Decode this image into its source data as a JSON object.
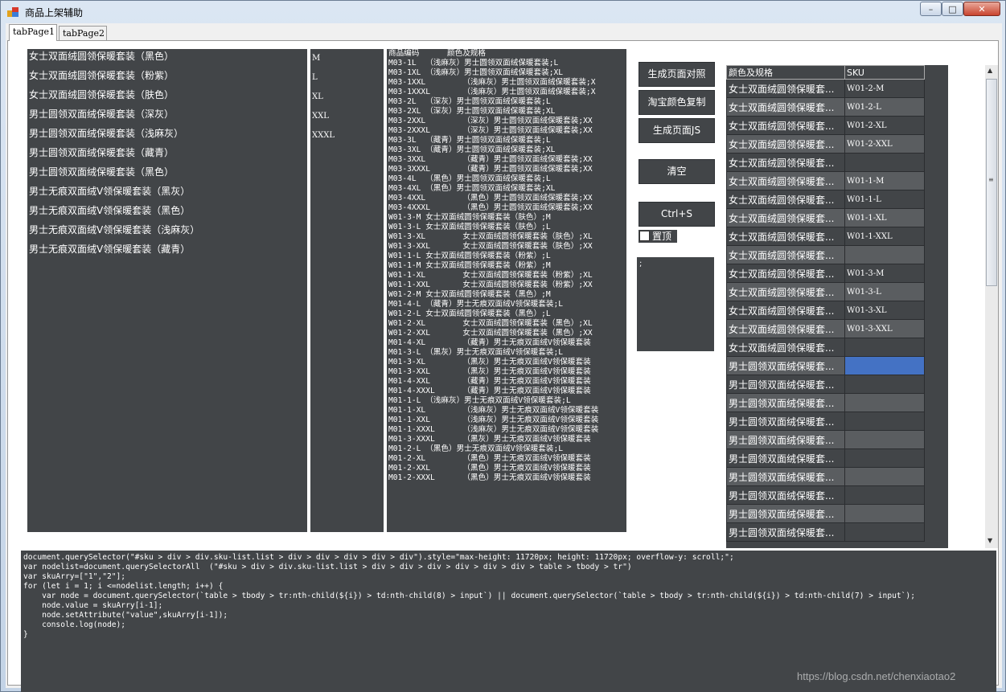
{
  "window": {
    "title": "商品上架辅助"
  },
  "tabs": [
    {
      "label": "tabPage1"
    },
    {
      "label": "tabPage2"
    }
  ],
  "product_list": [
    "女士双面绒圆领保暖套装（黑色）",
    "女士双面绒圆领保暖套装（粉紫）",
    "女士双面绒圆领保暖套装（肤色）",
    "男士圆领双面绒保暖套装（深灰）",
    "男士圆领双面绒保暖套装（浅麻灰）",
    "男士圆领双面绒保暖套装（藏青）",
    "男士圆领双面绒保暖套装（黑色）",
    "男士无痕双面绒V领保暖套装（黑灰）",
    "男士无痕双面绒V领保暖套装（黑色）",
    "男士无痕双面绒V领保暖套装（浅麻灰）",
    "男士无痕双面绒V领保暖套装（藏青）"
  ],
  "size_list": [
    "M",
    "L",
    "XL",
    "XXL",
    "XXXL"
  ],
  "code_list_header": "商品编码      颜色及规格",
  "code_list": [
    "M03-1L  （浅麻灰）男士圆领双面绒保暖套装;L",
    "M03-1XL （浅麻灰）男士圆领双面绒保暖套装;XL",
    "M03-1XXL        （浅麻灰）男士圆领双面绒保暖套装;X",
    "M03-1XXXL       （浅麻灰）男士圆领双面绒保暖套装;X",
    "M03-2L  （深灰）男士圆领双面绒保暖套装;L",
    "M03-2XL （深灰）男士圆领双面绒保暖套装;XL",
    "M03-2XXL        （深灰）男士圆领双面绒保暖套装;XX",
    "M03-2XXXL       （深灰）男士圆领双面绒保暖套装;XX",
    "M03-3L  （藏青）男士圆领双面绒保暖套装;L",
    "M03-3XL （藏青）男士圆领双面绒保暖套装;XL",
    "M03-3XXL        （藏青）男士圆领双面绒保暖套装;XX",
    "M03-3XXXL       （藏青）男士圆领双面绒保暖套装;XX",
    "M03-4L  （黑色）男士圆领双面绒保暖套装;L",
    "M03-4XL （黑色）男士圆领双面绒保暖套装;XL",
    "M03-4XXL        （黑色）男士圆领双面绒保暖套装;XX",
    "M03-4XXXL       （黑色）男士圆领双面绒保暖套装;XX",
    "W01-3-M 女士双面绒圆领保暖套装（肤色）;M",
    "W01-3-L 女士双面绒圆领保暖套装（肤色）;L",
    "W01-3-XL        女士双面绒圆领保暖套装（肤色）;XL",
    "W01-3-XXL       女士双面绒圆领保暖套装（肤色）;XX",
    "W01-1-L 女士双面绒圆领保暖套装（粉紫）;L",
    "W01-1-M 女士双面绒圆领保暖套装（粉紫）;M",
    "W01-1-XL        女士双面绒圆领保暖套装（粉紫）;XL",
    "W01-1-XXL       女士双面绒圆领保暖套装（粉紫）;XX",
    "W01-2-M 女士双面绒圆领保暖套装（黑色）;M",
    "M01-4-L （藏青）男士无痕双面绒V领保暖套装;L",
    "W01-2-L 女士双面绒圆领保暖套装（黑色）;L",
    "W01-2-XL        女士双面绒圆领保暖套装（黑色）;XL",
    "W01-2-XXL       女士双面绒圆领保暖套装（黑色）;XX",
    "M01-4-XL        （藏青）男士无痕双面绒V领保暖套装",
    "M01-3-L （黑灰）男士无痕双面绒V领保暖套装;L",
    "M01-3-XL        （黑灰）男士无痕双面绒V领保暖套装",
    "M01-3-XXL       （黑灰）男士无痕双面绒V领保暖套装",
    "M01-4-XXL       （藏青）男士无痕双面绒V领保暖套装",
    "M01-4-XXXL      （藏青）男士无痕双面绒V领保暖套装",
    "M01-1-L （浅麻灰）男士无痕双面绒V领保暖套装;L",
    "M01-1-XL        （浅麻灰）男士无痕双面绒V领保暖套装",
    "M01-1-XXL       （浅麻灰）男士无痕双面绒V领保暖套装",
    "M01-1-XXXL      （浅麻灰）男士无痕双面绒V领保暖套装",
    "M01-3-XXXL      （黑灰）男士无痕双面绒V领保暖套装",
    "M01-2-L （黑色）男士无痕双面绒V领保暖套装;L",
    "M01-2-XL        （黑色）男士无痕双面绒V领保暖套装",
    "M01-2-XXL       （黑色）男士无痕双面绒V领保暖套装",
    "M01-2-XXXL      （黑色）男士无痕双面绒V领保暖套装"
  ],
  "buttons": {
    "generate_page_match": "生成页面对照",
    "taobao_color_copy": "淘宝颜色复制",
    "generate_page_js": "生成页面JS",
    "clear": "清空",
    "ctrl_s": "Ctrl+S"
  },
  "pin_checkbox": {
    "label": "置顶",
    "checked": false
  },
  "small_output": ";",
  "grid": {
    "headers": [
      "颜色及规格",
      "SKU"
    ],
    "rows": [
      {
        "name": "女士双面绒圆领保暖套...",
        "sku": "W01-2-M"
      },
      {
        "name": "女士双面绒圆领保暖套...",
        "sku": "W01-2-L"
      },
      {
        "name": "女士双面绒圆领保暖套...",
        "sku": "W01-2-XL"
      },
      {
        "name": "女士双面绒圆领保暖套...",
        "sku": "W01-2-XXL"
      },
      {
        "name": "女士双面绒圆领保暖套...",
        "sku": ""
      },
      {
        "name": "女士双面绒圆领保暖套...",
        "sku": "W01-1-M"
      },
      {
        "name": "女士双面绒圆领保暖套...",
        "sku": "W01-1-L"
      },
      {
        "name": "女士双面绒圆领保暖套...",
        "sku": "W01-1-XL"
      },
      {
        "name": "女士双面绒圆领保暖套...",
        "sku": "W01-1-XXL"
      },
      {
        "name": "女士双面绒圆领保暖套...",
        "sku": ""
      },
      {
        "name": "女士双面绒圆领保暖套...",
        "sku": "W01-3-M"
      },
      {
        "name": "女士双面绒圆领保暖套...",
        "sku": "W01-3-L"
      },
      {
        "name": "女士双面绒圆领保暖套...",
        "sku": "W01-3-XL"
      },
      {
        "name": "女士双面绒圆领保暖套...",
        "sku": "W01-3-XXL"
      },
      {
        "name": "女士双面绒圆领保暖套...",
        "sku": ""
      },
      {
        "name": "男士圆领双面绒保暖套...",
        "sku": "",
        "selected": true
      },
      {
        "name": "男士圆领双面绒保暖套...",
        "sku": ""
      },
      {
        "name": "男士圆领双面绒保暖套...",
        "sku": ""
      },
      {
        "name": "男士圆领双面绒保暖套...",
        "sku": ""
      },
      {
        "name": "男士圆领双面绒保暖套...",
        "sku": ""
      },
      {
        "name": "男士圆领双面绒保暖套...",
        "sku": ""
      },
      {
        "name": "男士圆领双面绒保暖套...",
        "sku": ""
      },
      {
        "name": "男士圆领双面绒保暖套...",
        "sku": ""
      },
      {
        "name": "男士圆领双面绒保暖套...",
        "sku": ""
      },
      {
        "name": "男士圆领双面绒保暖套...",
        "sku": ""
      }
    ]
  },
  "code_output": "document.querySelector(\"#sku > div > div.sku-list.list > div > div > div > div > div\").style=\"max-height: 11720px; height: 11720px; overflow-y: scroll;\";\nvar nodelist=document.querySelectorAll  (\"#sku > div > div.sku-list.list > div > div > div > div > div > div > table > tbody > tr\")\nvar skuArry=[\"1\",\"2\"];\nfor (let i = 1; i <=nodelist.length; i++) {\n    var node = document.querySelector(`table > tbody > tr:nth-child(${i}) > td:nth-child(8) > input`) || document.querySelector(`table > tbody > tr:nth-child(${i}) > td:nth-child(7) > input`);\n    node.value = skuArry[i-1];\n    node.setAttribute(\"value\",skuArry[i-1]);\n    console.log(node);\n}",
  "watermark": "https://blog.csdn.net/chenxiaotao2",
  "colors": {
    "panel": "#424548",
    "selected_row": "#4472c4",
    "alt_row": "#5a5d60"
  }
}
